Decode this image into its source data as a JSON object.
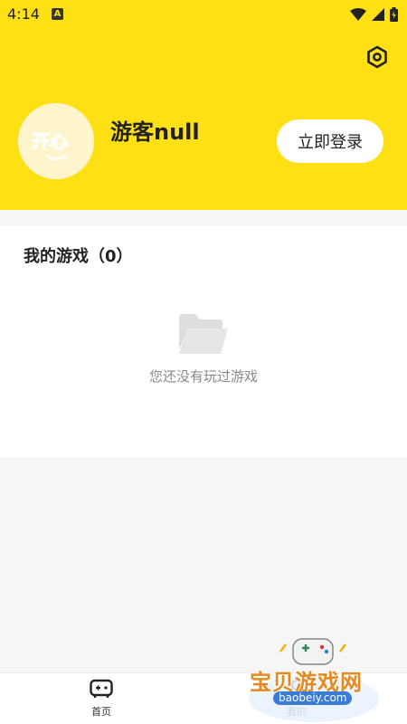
{
  "status_bar": {
    "time": "4:14",
    "notification_badge": "A",
    "icons": [
      "wifi-icon",
      "signal-icon",
      "battery-icon"
    ]
  },
  "profile": {
    "avatar_text": "开心",
    "username": "游客null",
    "login_label": "立即登录"
  },
  "my_games": {
    "title": "我的游戏（0）",
    "empty_text": "您还没有玩过游戏"
  },
  "bottom_nav": {
    "items": [
      {
        "label": "首页",
        "icon": "gamepad-icon"
      },
      {
        "label": "我的",
        "icon": "user-icon"
      }
    ]
  },
  "watermark": {
    "title": "宝贝游戏网",
    "url": "baobeiy.com"
  },
  "colors": {
    "brand_yellow": "#ffe014",
    "background": "#f6f6f6"
  }
}
